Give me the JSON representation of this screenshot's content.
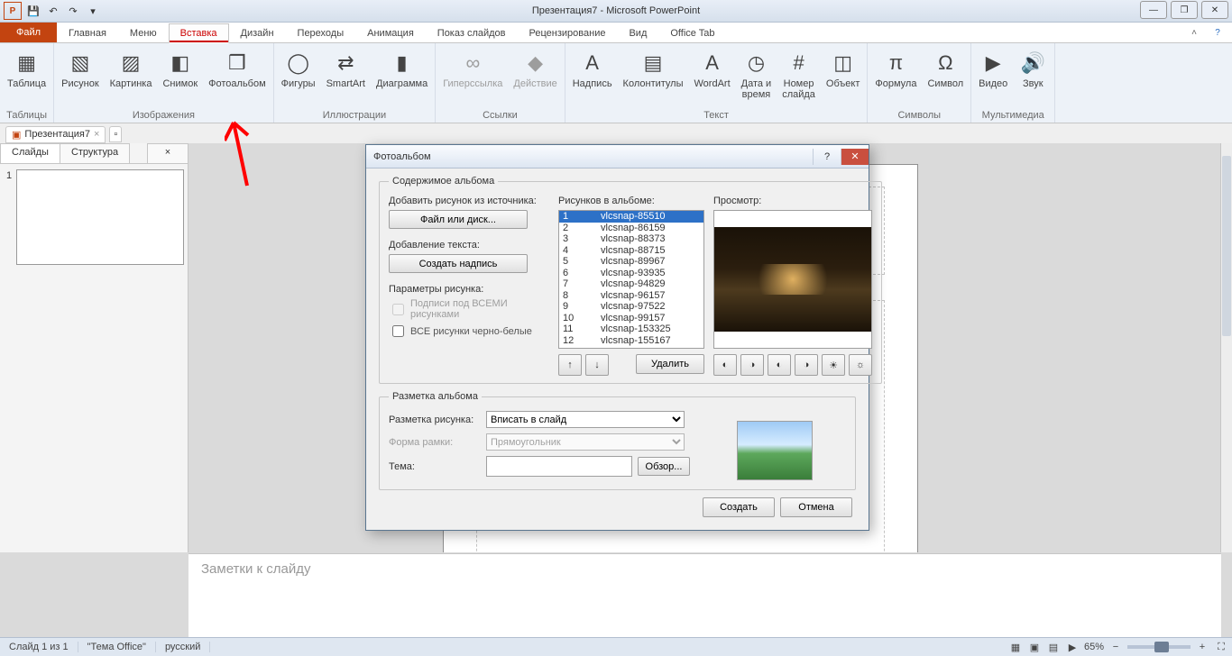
{
  "title": "Презентация7 - Microsoft PowerPoint",
  "qat": {
    "icons": [
      "app",
      "save",
      "undo",
      "redo",
      "down"
    ]
  },
  "window_btns": [
    "—",
    "❐",
    "✕"
  ],
  "file_tab": "Файл",
  "tabs": [
    "Главная",
    "Меню",
    "Вставка",
    "Дизайн",
    "Переходы",
    "Анимация",
    "Показ слайдов",
    "Рецензирование",
    "Вид",
    "Office Tab"
  ],
  "active_tab": "Вставка",
  "ribbon": [
    {
      "label": "Таблицы",
      "items": [
        {
          "t": "Таблица",
          "i": "▦"
        }
      ]
    },
    {
      "label": "Изображения",
      "items": [
        {
          "t": "Рисунок",
          "i": "▧"
        },
        {
          "t": "Картинка",
          "i": "▨"
        },
        {
          "t": "Снимок",
          "i": "◧"
        },
        {
          "t": "Фотоальбом",
          "i": "❒"
        }
      ]
    },
    {
      "label": "Иллюстрации",
      "items": [
        {
          "t": "Фигуры",
          "i": "◯"
        },
        {
          "t": "SmartArt",
          "i": "⇄"
        },
        {
          "t": "Диаграмма",
          "i": "▮"
        }
      ]
    },
    {
      "label": "Ссылки",
      "items": [
        {
          "t": "Гиперссылка",
          "i": "∞",
          "d": true
        },
        {
          "t": "Действие",
          "i": "◆",
          "d": true
        }
      ]
    },
    {
      "label": "Текст",
      "items": [
        {
          "t": "Надпись",
          "i": "A"
        },
        {
          "t": "Колонтитулы",
          "i": "▤"
        },
        {
          "t": "WordArt",
          "i": "A"
        },
        {
          "t": "Дата и\nвремя",
          "i": "◷"
        },
        {
          "t": "Номер\nслайда",
          "i": "#"
        },
        {
          "t": "Объект",
          "i": "◫"
        }
      ]
    },
    {
      "label": "Символы",
      "items": [
        {
          "t": "Формула",
          "i": "π"
        },
        {
          "t": "Символ",
          "i": "Ω"
        }
      ]
    },
    {
      "label": "Мультимедиа",
      "items": [
        {
          "t": "Видео",
          "i": "▶"
        },
        {
          "t": "Звук",
          "i": "🔊"
        }
      ]
    }
  ],
  "doc_tab": "Презентация7",
  "side": {
    "tabs": [
      "Слайды",
      "Структура"
    ],
    "active": "Слайды",
    "slide_num": "1"
  },
  "notes_placeholder": "Заметки к слайду",
  "dialog": {
    "title": "Фотоальбом",
    "group": "Содержимое альбома",
    "add_label": "Добавить рисунок из источника:",
    "file_btn": "Файл или диск...",
    "text_label": "Добавление текста:",
    "textbtn": "Создать надпись",
    "params": "Параметры рисунка:",
    "chk1": "Подписи под ВСЕМИ рисунками",
    "chk2": "ВСЕ рисунки черно-белые",
    "list_label": "Рисунков в альбоме:",
    "preview_label": "Просмотр:",
    "rows": [
      {
        "n": "1",
        "name": "vlcsnap-85510",
        "sel": true
      },
      {
        "n": "2",
        "name": "vlcsnap-86159"
      },
      {
        "n": "3",
        "name": "vlcsnap-88373"
      },
      {
        "n": "4",
        "name": "vlcsnap-88715"
      },
      {
        "n": "5",
        "name": "vlcsnap-89967"
      },
      {
        "n": "6",
        "name": "vlcsnap-93935"
      },
      {
        "n": "7",
        "name": "vlcsnap-94829"
      },
      {
        "n": "8",
        "name": "vlcsnap-96157"
      },
      {
        "n": "9",
        "name": "vlcsnap-97522"
      },
      {
        "n": "10",
        "name": "vlcsnap-99157"
      },
      {
        "n": "11",
        "name": "vlcsnap-153325"
      },
      {
        "n": "12",
        "name": "vlcsnap-155167"
      }
    ],
    "up": "↑",
    "down": "↓",
    "delete": "Удалить",
    "prev_tools": [
      "◐",
      "◑",
      "◐",
      "◑",
      "☀",
      "☼"
    ],
    "layout_group": "Разметка альбома",
    "layout_label": "Разметка рисунка:",
    "layout_val": "Вписать в слайд",
    "frame_label": "Форма рамки:",
    "frame_val": "Прямоугольник",
    "theme_label": "Тема:",
    "browse": "Обзор...",
    "create": "Создать",
    "cancel": "Отмена"
  },
  "status": {
    "slide": "Слайд 1 из 1",
    "theme": "\"Тема Office\"",
    "lang": "русский",
    "zoom": "65%"
  }
}
